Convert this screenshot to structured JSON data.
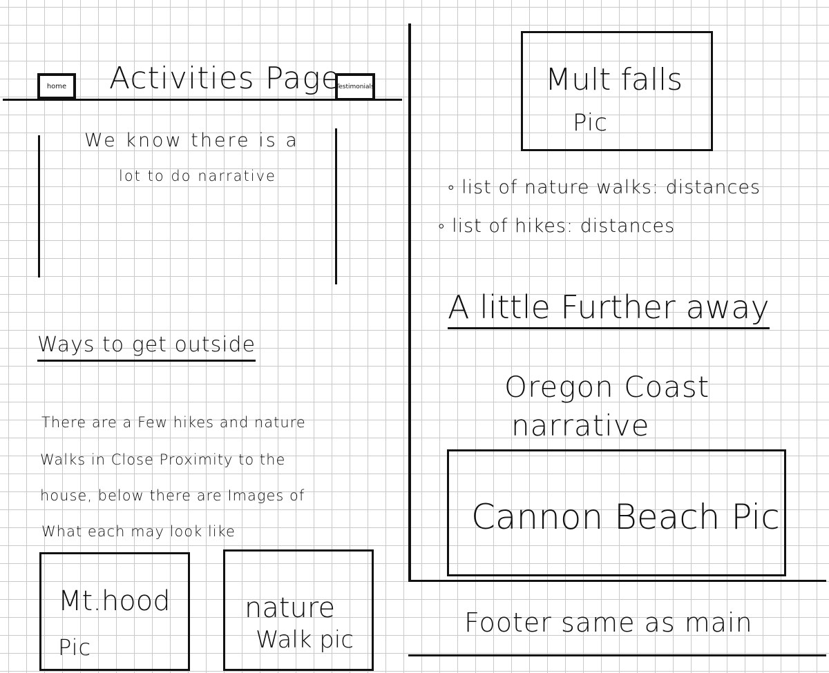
{
  "header": {
    "title": "Activities Page",
    "home_button": "home",
    "testimonials_button": "Testimonials"
  },
  "intro": {
    "line1": "We know there is a",
    "line2": "lot to do narrative"
  },
  "ways": {
    "heading": "Ways to get outside",
    "para": [
      "There are a Few hikes and nature",
      "Walks in Close Proximity to the",
      "house, below there are Images of",
      "What each may look like"
    ]
  },
  "pics": {
    "mt_hood": [
      "Mt.hood",
      "Pic"
    ],
    "nature_walk": [
      "nature",
      "Walk pic"
    ],
    "multnomah": [
      "Mult falls",
      "Pic"
    ],
    "cannon": "Cannon Beach Pic"
  },
  "lists": {
    "walks": "list of nature walks: distances",
    "hikes": "list of hikes: distances"
  },
  "further": {
    "heading": "A little Further away",
    "narrative": [
      "Oregon Coast",
      "narrative"
    ]
  },
  "footer": {
    "text": "Footer same as main"
  }
}
